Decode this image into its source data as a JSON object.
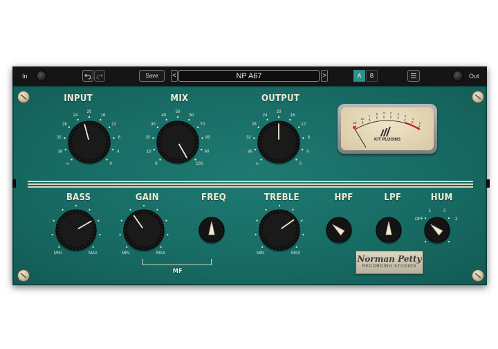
{
  "topbar": {
    "in_label": "In",
    "out_label": "Out",
    "save_label": "Save",
    "preset_name": "NP A67",
    "prev_arrow": "<",
    "next_arrow": ">",
    "ab_a": "A",
    "ab_b": "B",
    "undo_icon": "undo-icon",
    "redo_icon": "redo-icon",
    "menu_icon": "hamburger-menu-icon"
  },
  "top_knobs": {
    "input": {
      "label": "INPUT",
      "scale": [
        "∞",
        "36",
        "32",
        "28",
        "24",
        "20",
        "16",
        "12",
        "8",
        "4",
        "0"
      ]
    },
    "mix": {
      "label": "MIX",
      "scale": [
        "0",
        "10",
        "20",
        "30",
        "40",
        "50",
        "60",
        "70",
        "80",
        "90",
        "100"
      ]
    },
    "output": {
      "label": "OUTPUT",
      "scale": [
        "∞",
        "36",
        "32",
        "28",
        "24",
        "20",
        "16",
        "12",
        "8",
        "4",
        "0"
      ]
    }
  },
  "meter": {
    "brand": "KIT PLUGINS",
    "scale": [
      "20",
      "10",
      "7",
      "5",
      "3",
      "2",
      "1",
      "0",
      "1",
      "2",
      "3"
    ]
  },
  "bottom": {
    "bass": {
      "label": "BASS",
      "min": "MIN",
      "max": "MAX"
    },
    "gain": {
      "label": "GAIN",
      "min": "MIN",
      "max": "MAX"
    },
    "freq": {
      "label": "FREQ"
    },
    "treble": {
      "label": "TREBLE",
      "min": "MIN",
      "max": "MAX"
    },
    "hpf": {
      "label": "HPF"
    },
    "lpf": {
      "label": "LPF"
    },
    "hum": {
      "label": "HUM",
      "positions": [
        "OFF",
        "1",
        "2",
        "3"
      ]
    },
    "mf_label": "MF"
  },
  "badge": {
    "line1": "Norman Petty",
    "line2": "RECORDING STUDIOS"
  },
  "colors": {
    "panel": "#1a746c",
    "cream": "#f1ead6",
    "accent_a": "#2f8f8a"
  }
}
